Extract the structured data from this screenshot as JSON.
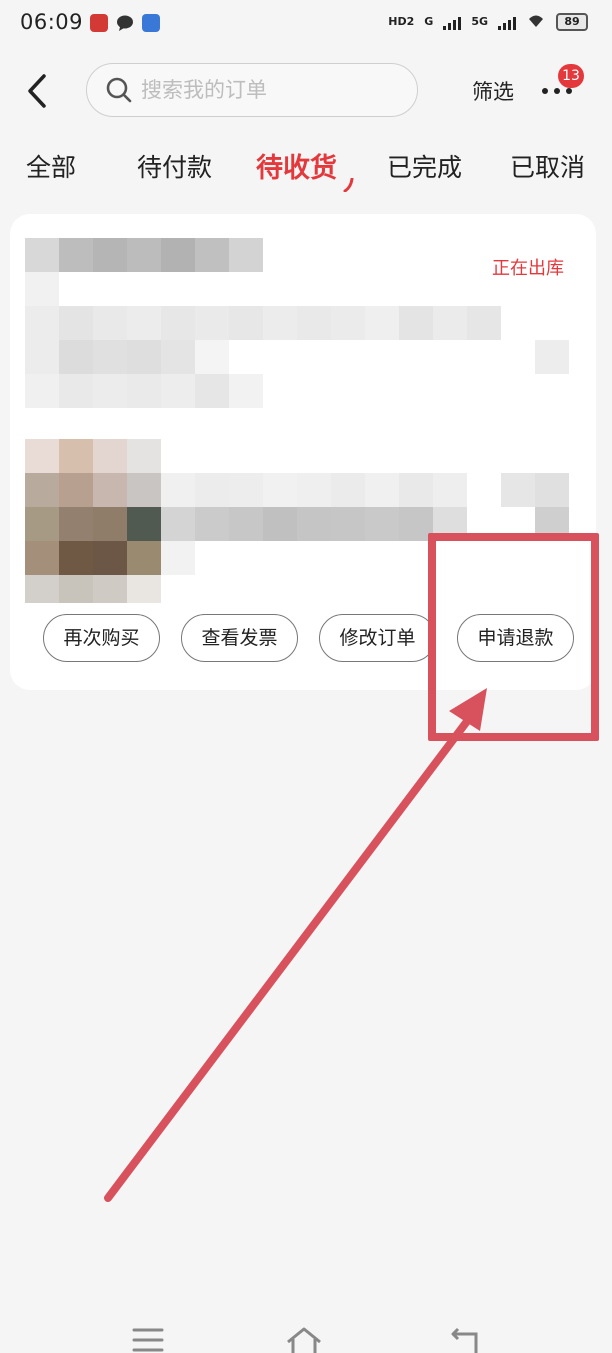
{
  "status_bar": {
    "time": "06:09",
    "network_hd": "HD2",
    "network_g": "G",
    "network_5g": "5G",
    "battery": "89"
  },
  "search": {
    "placeholder": "搜索我的订单"
  },
  "header": {
    "filter_label": "筛选",
    "more_badge": "13"
  },
  "tabs": [
    {
      "label": "全部",
      "active": false
    },
    {
      "label": "待付款",
      "active": false
    },
    {
      "label": "待收货",
      "active": true
    },
    {
      "label": "已完成",
      "active": false
    },
    {
      "label": "已取消",
      "active": false
    }
  ],
  "order": {
    "status": "正在出库",
    "actions": [
      {
        "label": "再次购买"
      },
      {
        "label": "查看发票"
      },
      {
        "label": "修改订单"
      },
      {
        "label": "申请退款"
      }
    ]
  },
  "colors": {
    "accent": "#e4393c",
    "annotation": "#d8525e",
    "background": "#f5f5f5"
  },
  "icons": {
    "back": "chevron-left-icon",
    "search": "search-icon",
    "more": "more-dots-icon",
    "nav_menu": "menu-icon",
    "nav_home": "home-icon",
    "nav_back": "return-icon"
  }
}
